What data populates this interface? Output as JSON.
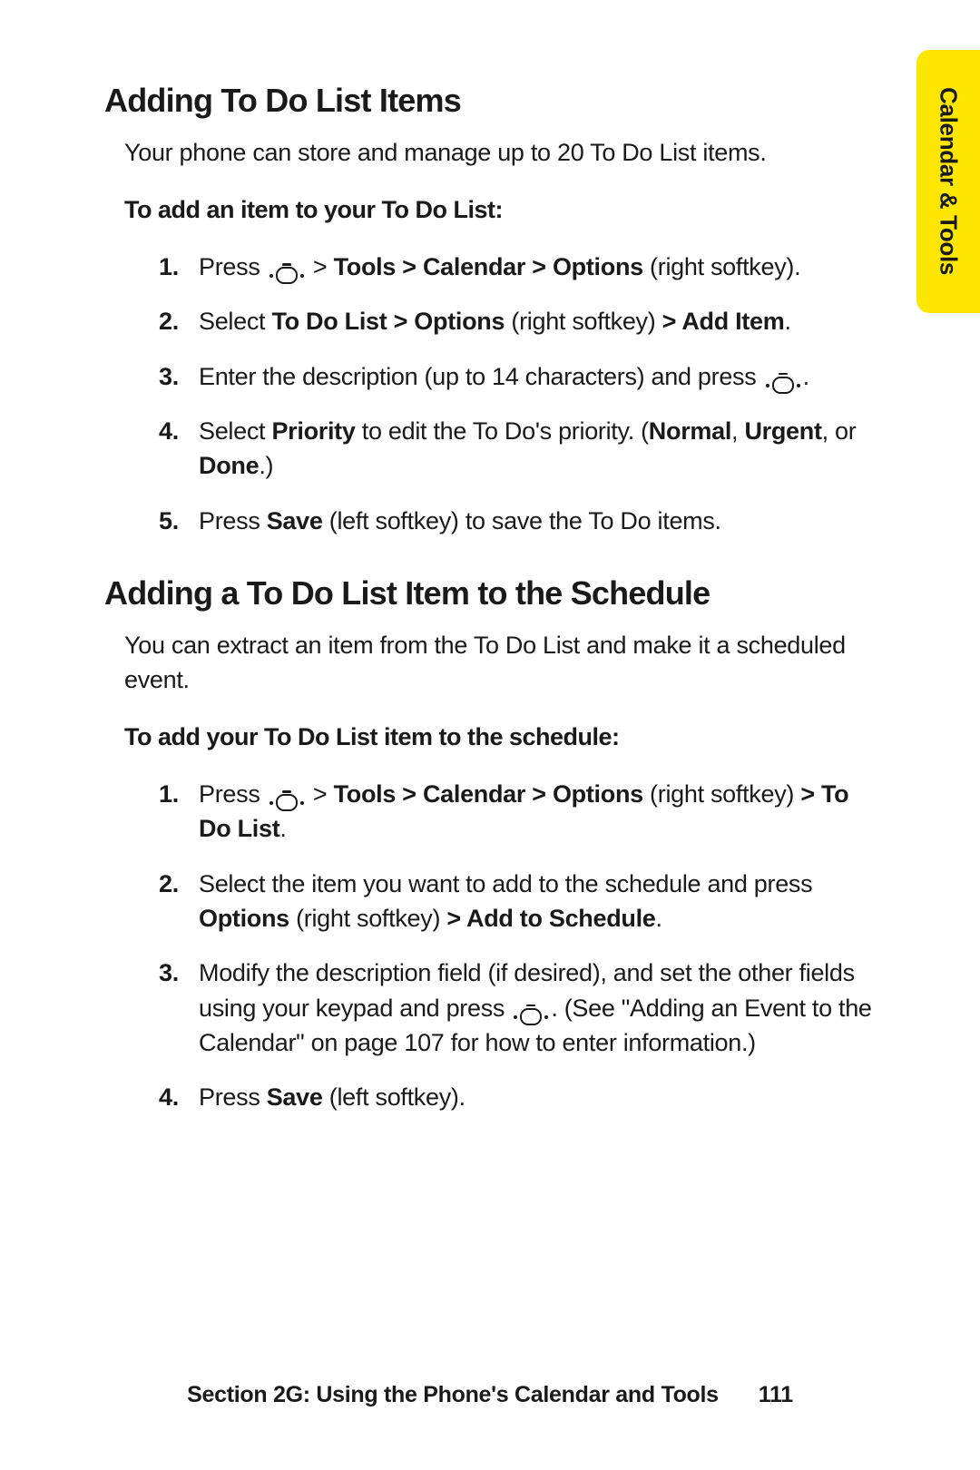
{
  "sideTab": "Calendar & Tools",
  "sectionA": {
    "heading": "Adding To Do List Items",
    "intro": "Your phone can store and manage up to 20 To Do List items.",
    "lead": "To add an item to your To Do List:",
    "steps": [
      {
        "num": "1.",
        "pre": "Press ",
        "icon": "top",
        "t1": " > ",
        "b1": "Tools > Calendar > Options",
        "t2": " (right softkey)."
      },
      {
        "num": "2.",
        "pre": "Select ",
        "b1": "To Do List > Options",
        "t1": " (right softkey) ",
        "b2": "> Add Item",
        "t2": "."
      },
      {
        "num": "3.",
        "pre": "Enter the description (up to 14 characters) and press ",
        "icon": "top",
        "t1": "."
      },
      {
        "num": "4.",
        "pre": "Select ",
        "b1": "Priority",
        "t1": " to edit the To Do's priority. (",
        "b2": "Normal",
        "t2": ", ",
        "b3": "Urgent",
        "t3": ", or ",
        "b4": "Done",
        "t4": ".)"
      },
      {
        "num": "5.",
        "pre": "Press ",
        "b1": "Save",
        "t1": " (left softkey) to save the To Do items."
      }
    ]
  },
  "sectionB": {
    "heading": "Adding a To Do List Item to the Schedule",
    "intro": "You can extract an item from the To Do List and make it a scheduled event.",
    "lead": "To add your To Do List item to the schedule:",
    "steps": [
      {
        "num": "1.",
        "pre": "Press ",
        "icon": "top",
        "t1": " > ",
        "b1": "Tools > Calendar > Options",
        "t2": " (right softkey) ",
        "b2": "> To Do List",
        "t3": "."
      },
      {
        "num": "2.",
        "pre": "Select the item you want to add to the schedule and press ",
        "b1": "Options",
        "t1": " (right softkey) ",
        "b2": "> Add to Schedule",
        "t2": "."
      },
      {
        "num": "3.",
        "pre": "Modify the description field (if desired), and set the other fields using your keypad and press ",
        "icon": "top",
        "t1": ". (See \"Adding an Event to the Calendar\" on page 107 for how to enter information.)"
      },
      {
        "num": "4.",
        "pre": "Press ",
        "b1": "Save",
        "t1": " (left softkey)."
      }
    ]
  },
  "footer": {
    "title": "Section 2G: Using the Phone's Calendar and Tools",
    "page": "111"
  }
}
